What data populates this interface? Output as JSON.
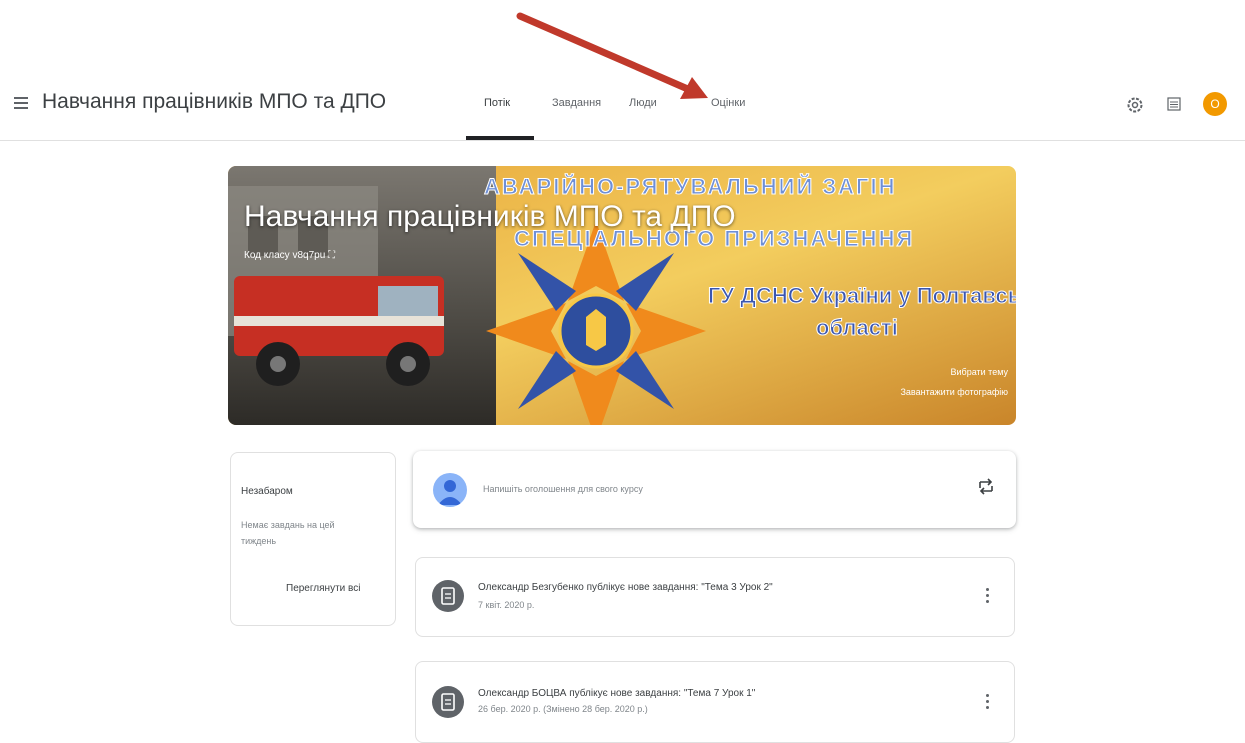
{
  "header": {
    "class_title": "Навчання працівників МПО та ДПО",
    "tabs": [
      {
        "label": "Потік",
        "active": true
      },
      {
        "label": "Завдання",
        "active": false
      },
      {
        "label": "Люди",
        "active": false
      },
      {
        "label": "Оцінки",
        "active": false
      }
    ],
    "avatar_letter": "О",
    "icons": [
      "menu-icon",
      "settings-icon",
      "apps-icon"
    ]
  },
  "banner": {
    "title": "Навчання працівників МПО та ДПО",
    "class_code_label": "Код класу",
    "class_code": "v8q7pu",
    "image_text": {
      "line1": "АВАРІЙНО-РЯТУВАЛЬНИЙ ЗАГІН",
      "line2": "СПЕЦІАЛЬНОГО ПРИЗНАЧЕННЯ",
      "line3": "ГУ ДСНС України у Полтавській",
      "line4": "області"
    },
    "select_theme": "Вибрати тему",
    "upload_photo": "Завантажити фотографію"
  },
  "upcoming": {
    "title": "Незабаром",
    "empty_text": "Немає завдань на цей тиждень",
    "view_all": "Переглянути всі"
  },
  "announce": {
    "placeholder": "Напишіть оголошення для свого курсу"
  },
  "posts": [
    {
      "title": "Олександр Безгубенко публікує нове завдання: \"Тема 3 Урок 2\"",
      "date": "7 квіт. 2020 р."
    },
    {
      "title": "Олександр БОЦВА публікує нове завдання: \"Тема 7 Урок 1\"",
      "date": "26 бер. 2020 р. (Змінено 28 бер. 2020 р.)"
    }
  ],
  "colors": {
    "accent": "#f29900",
    "tab_underline": "#202124",
    "arrow": "#c0392b"
  }
}
